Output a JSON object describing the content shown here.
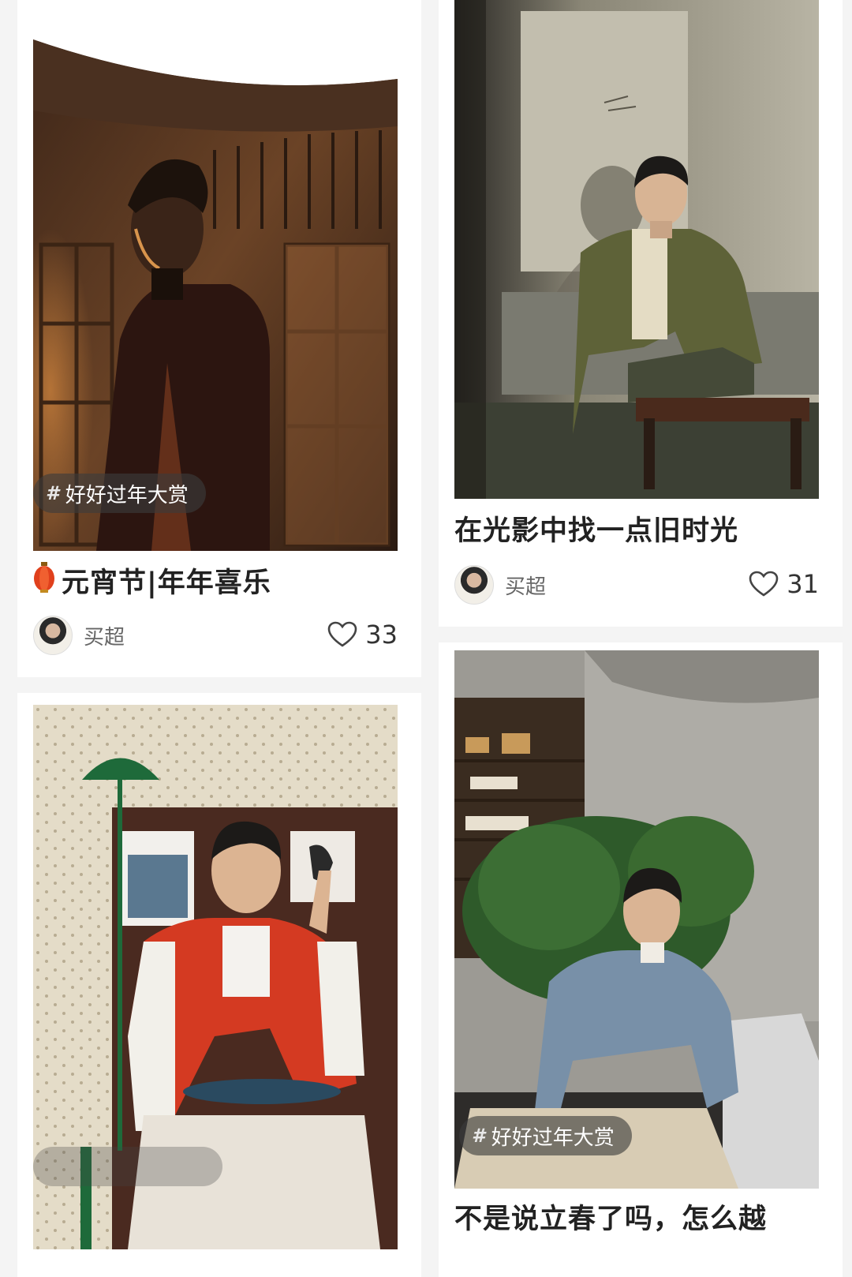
{
  "feed": {
    "cards": [
      {
        "tag": "好好过年大赏",
        "title_icon": "lantern-emoji",
        "title": "元宵节|年年喜乐",
        "author": "买超",
        "likes": "33",
        "photo_icon": "portrait-photo-dark-interior"
      },
      {
        "title": "在光影中找一点旧时光",
        "author": "买超",
        "likes": "31",
        "photo_icon": "portrait-photo-olive-coat"
      },
      {
        "photo_icon": "portrait-photo-red-varsity-jacket"
      },
      {
        "tag": "好好过年大赏",
        "title": "不是说立春了吗，怎么越",
        "photo_icon": "portrait-photo-blue-sweater"
      }
    ]
  }
}
